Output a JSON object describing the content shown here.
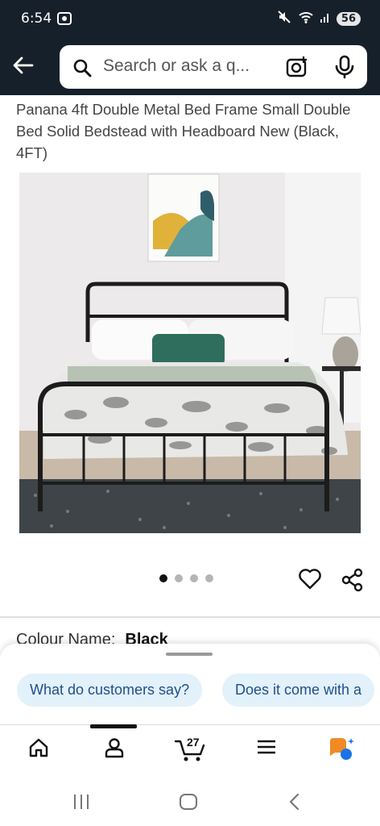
{
  "status_bar": {
    "time": "6:54",
    "battery": "56"
  },
  "header": {
    "back_icon": "back-arrow-icon",
    "search_placeholder": "Search or ask a q...",
    "camera_icon": "camera-icon",
    "mic_icon": "mic-icon"
  },
  "product": {
    "title": "Panana 4ft Double Metal Bed Frame Small Double Bed Solid Bedstead with Headboard New (Black, 4FT)",
    "image_count": 4,
    "active_image": 1
  },
  "colour": {
    "label": "Colour Name:",
    "value": "Black"
  },
  "suggestions": [
    "What do customers say?",
    "Does it come with a"
  ],
  "bottom_nav": {
    "items": [
      "home-icon",
      "account-icon",
      "cart-icon",
      "menu-icon",
      "assistant-icon"
    ],
    "cart_count": "27",
    "active_index": 1
  },
  "colors": {
    "header_bg": "#16202b",
    "chip_bg": "#e3f1fb",
    "chip_text": "#1f4f8a",
    "assistant_orange": "#f08a24",
    "assistant_blue": "#1a73e8"
  }
}
